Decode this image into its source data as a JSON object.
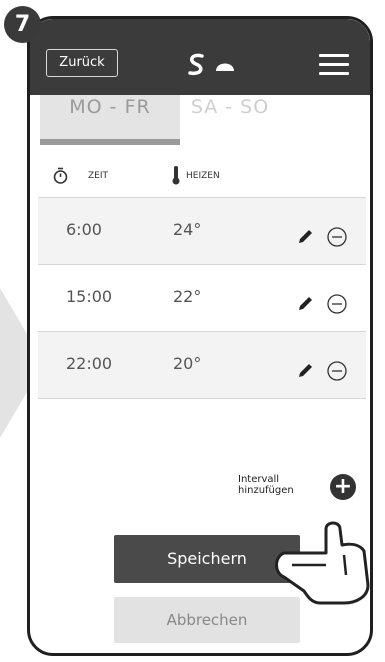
{
  "step": {
    "number": "7"
  },
  "header": {
    "back_label": "Zurück",
    "logo_icon": "app-logo-icon",
    "menu_icon": "hamburger-menu-icon"
  },
  "tabs": [
    {
      "label": "MO - FR",
      "active": true
    },
    {
      "label": "SA - SO",
      "active": false
    }
  ],
  "columns": {
    "time": "ZEIT",
    "heat": "HEIZEN"
  },
  "intervals": [
    {
      "time": "6:00",
      "temperature": "24°"
    },
    {
      "time": "15:00",
      "temperature": "22°"
    },
    {
      "time": "22:00",
      "temperature": "20°"
    }
  ],
  "add_interval": {
    "label_line1": "Intervall",
    "label_line2": "hinzufügen",
    "icon": "+"
  },
  "actions": {
    "save": "Speichern",
    "cancel": "Abbrechen"
  },
  "colors": {
    "header_bg": "#3b3b3b",
    "save_bg": "#4a4a4a",
    "cancel_bg": "#e2e2e2"
  }
}
